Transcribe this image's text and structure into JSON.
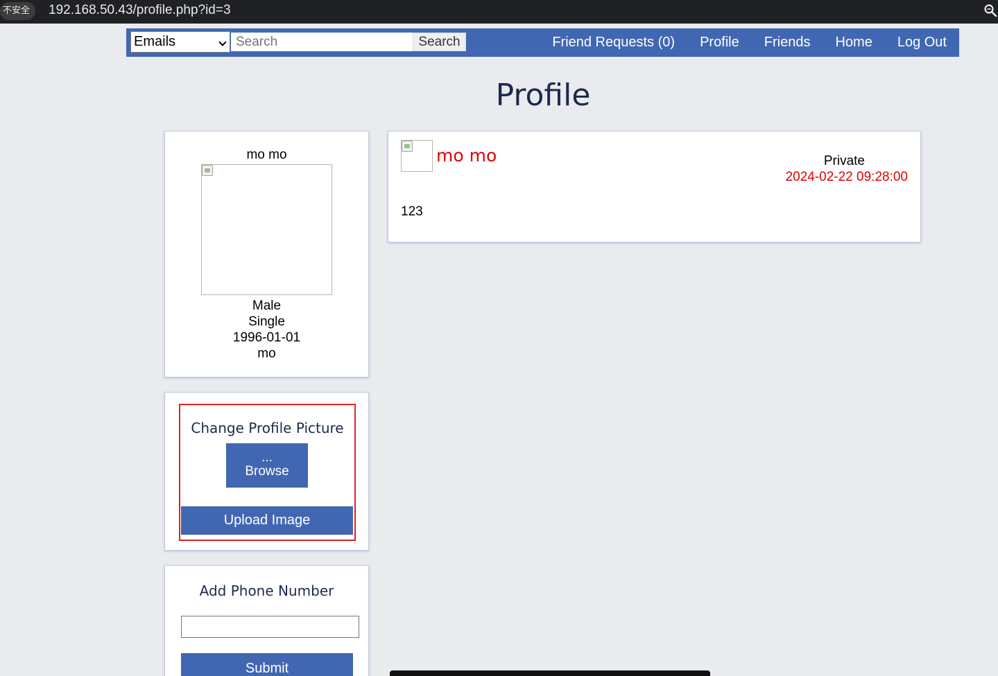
{
  "browser": {
    "insecure_label": "不安全",
    "url": "192.168.50.43/profile.php?id=3"
  },
  "navbar": {
    "select_value": "Emails",
    "search_placeholder": "Search",
    "search_button": "Search",
    "links": [
      "Friend Requests (0)",
      "Profile",
      "Friends",
      "Home",
      "Log Out"
    ]
  },
  "page": {
    "title": "Profile"
  },
  "profile": {
    "name": "mo mo",
    "gender": "Male",
    "relationship": "Single",
    "birthday": "1996-01-01",
    "nickname": "mo"
  },
  "upload": {
    "title": "Change Profile Picture",
    "browse_dots": "...",
    "browse_label": "Browse",
    "upload_label": "Upload Image"
  },
  "phone": {
    "title": "Add Phone Number",
    "value": "",
    "submit_label": "Submit"
  },
  "post": {
    "author": "mo mo",
    "privacy": "Private",
    "date": "2024-02-22 09:28:00",
    "body": "123"
  },
  "colors": {
    "brand": "#4267b2",
    "accent_red": "#e00000",
    "background": "#e9ebee"
  }
}
